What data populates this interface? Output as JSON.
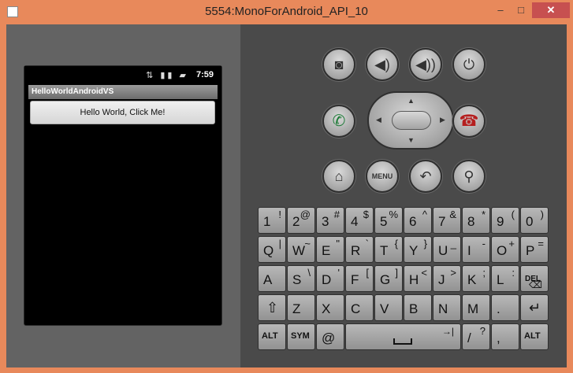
{
  "window": {
    "title": "5554:MonoForAndroid_API_10",
    "minimize": "–",
    "maximize": "□",
    "close": "✕",
    "icon": "emulator-window-icon"
  },
  "phone": {
    "status_icons": "⇅ ▮▮ ▰",
    "time": "7:59",
    "app_title": "HelloWorldAndroidVS",
    "button_label": "Hello World, Click Me!"
  },
  "hardware": {
    "camera": "camera-icon",
    "volume_down": "volume-down-icon",
    "volume_up": "volume-up-icon",
    "power": "power-icon",
    "call": "call-icon",
    "end_call": "end-call-icon",
    "home": "home-icon",
    "menu_label": "MENU",
    "back": "back-icon",
    "search": "search-icon",
    "arrow_up": "▲",
    "arrow_down": "▼",
    "arrow_left": "◀",
    "arrow_right": "▶"
  },
  "keyboard": {
    "number_row": [
      {
        "main": "1",
        "alt": "!"
      },
      {
        "main": "2",
        "alt": "@"
      },
      {
        "main": "3",
        "alt": "#"
      },
      {
        "main": "4",
        "alt": "$"
      },
      {
        "main": "5",
        "alt": "%"
      },
      {
        "main": "6",
        "alt": "^"
      },
      {
        "main": "7",
        "alt": "&"
      },
      {
        "main": "8",
        "alt": "*"
      },
      {
        "main": "9",
        "alt": "("
      },
      {
        "main": "0",
        "alt": ")"
      }
    ],
    "q_row": [
      {
        "main": "Q",
        "alt": "|"
      },
      {
        "main": "W",
        "alt": "~"
      },
      {
        "main": "E",
        "alt": "\""
      },
      {
        "main": "R",
        "alt": "`"
      },
      {
        "main": "T",
        "alt": "{"
      },
      {
        "main": "Y",
        "alt": "}"
      },
      {
        "main": "U",
        "alt": "_"
      },
      {
        "main": "I",
        "alt": "-"
      },
      {
        "main": "O",
        "alt": "+"
      },
      {
        "main": "P",
        "alt": "="
      }
    ],
    "a_row": [
      {
        "main": "A",
        "alt": ""
      },
      {
        "main": "S",
        "alt": "\\"
      },
      {
        "main": "D",
        "alt": "'"
      },
      {
        "main": "F",
        "alt": "["
      },
      {
        "main": "G",
        "alt": "]"
      },
      {
        "main": "H",
        "alt": "<"
      },
      {
        "main": "J",
        "alt": ">"
      },
      {
        "main": "K",
        "alt": ";"
      },
      {
        "main": "L",
        "alt": ":"
      }
    ],
    "del_label": "DEL",
    "z_row": [
      {
        "main": "Z",
        "alt": ""
      },
      {
        "main": "X",
        "alt": ""
      },
      {
        "main": "C",
        "alt": ""
      },
      {
        "main": "V",
        "alt": ""
      },
      {
        "main": "B",
        "alt": ""
      },
      {
        "main": "N",
        "alt": ""
      },
      {
        "main": "M",
        "alt": ""
      },
      {
        "main": ".",
        "alt": ""
      }
    ],
    "shift_icon": "shift-icon",
    "enter_icon": "enter-icon",
    "alt_label": "ALT",
    "sym_label": "SYM",
    "at_label": "@",
    "space_icon": "space-icon",
    "slash_main": "/",
    "slash_alt": "?",
    "comma": ","
  }
}
